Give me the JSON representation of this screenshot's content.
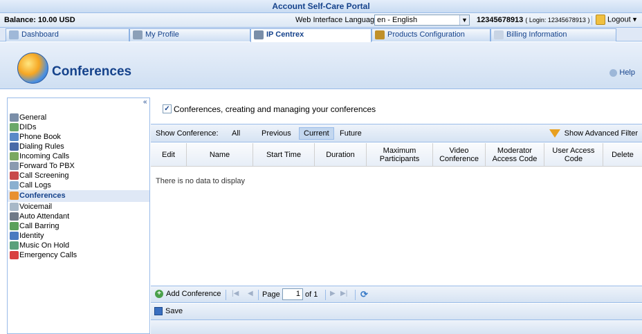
{
  "app": {
    "title": "Account Self-Care Portal"
  },
  "infobar": {
    "balance": "Balance: 10.00 USD",
    "language_label": "Web Interface Language:",
    "language_value": "en - English",
    "account": "12345678913",
    "login_text": "( Login: 12345678913 )",
    "logout": "Logout"
  },
  "tabs": [
    {
      "label": "Dashboard",
      "icon": "dashboard-icon"
    },
    {
      "label": "My Profile",
      "icon": "profile-icon"
    },
    {
      "label": "IP Centrex",
      "icon": "gear-icon",
      "active": true
    },
    {
      "label": "Products Configuration",
      "icon": "products-icon"
    },
    {
      "label": "Billing Information",
      "icon": "billing-icon"
    }
  ],
  "header": {
    "title": "Conferences",
    "help": "Help"
  },
  "sidebar": {
    "items": [
      {
        "label": "General"
      },
      {
        "label": "DIDs"
      },
      {
        "label": "Phone Book"
      },
      {
        "label": "Dialing Rules"
      },
      {
        "label": "Incoming Calls"
      },
      {
        "label": "Forward To PBX"
      },
      {
        "label": "Call Screening"
      },
      {
        "label": "Call Logs"
      },
      {
        "label": "Conferences",
        "active": true
      },
      {
        "label": "Voicemail"
      },
      {
        "label": "Auto Attendant"
      },
      {
        "label": "Call Barring"
      },
      {
        "label": "Identity"
      },
      {
        "label": "Music On Hold"
      },
      {
        "label": "Emergency Calls"
      }
    ]
  },
  "main": {
    "checkbox_label": "Conferences, creating and managing your conferences",
    "show_label": "Show Conference:",
    "filters": [
      "All",
      "Previous",
      "Current",
      "Future"
    ],
    "active_filter": "Current",
    "advanced_filter": "Show Advanced Filter",
    "columns": [
      "Edit",
      "Name",
      "Start Time",
      "Duration",
      "Maximum Participants",
      "Video Conference",
      "Moderator Access Code",
      "User Access Code",
      "Delete"
    ],
    "empty_text": "There is no data to display",
    "add_label": "Add Conference",
    "page_label": "Page",
    "page_value": "1",
    "page_of": "of 1",
    "save_label": "Save"
  }
}
